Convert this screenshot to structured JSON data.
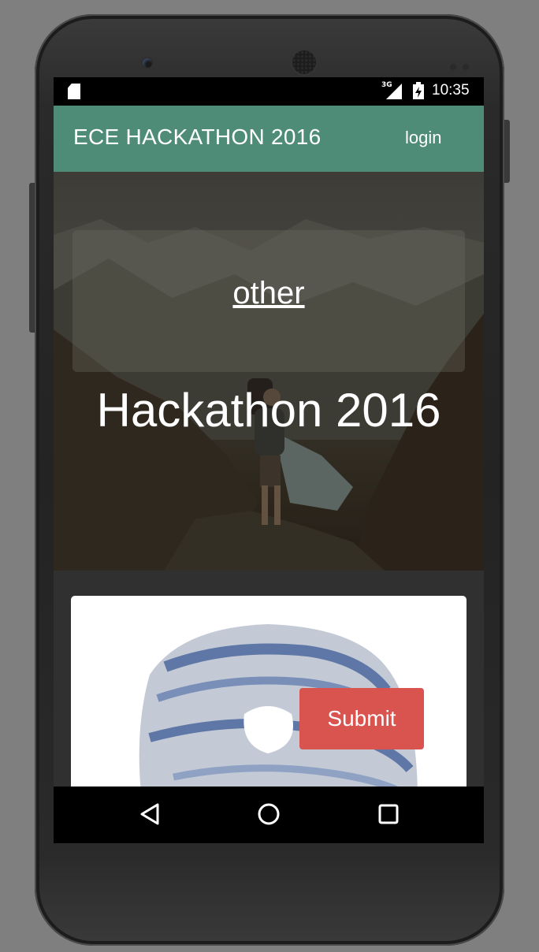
{
  "status_bar": {
    "network": "3G",
    "time": "10:35"
  },
  "app_bar": {
    "title": "ECE HACKATHON 2016",
    "login": "login"
  },
  "hero": {
    "link": "other",
    "heading": "Hackathon 2016"
  },
  "card": {
    "submit": "Submit",
    "accent": "#d9534f"
  },
  "colors": {
    "app_bar": "#4e8c78",
    "content_bg": "#303030"
  },
  "nav": {
    "icons": [
      "back-triangle-icon",
      "home-circle-icon",
      "recents-square-icon"
    ]
  }
}
